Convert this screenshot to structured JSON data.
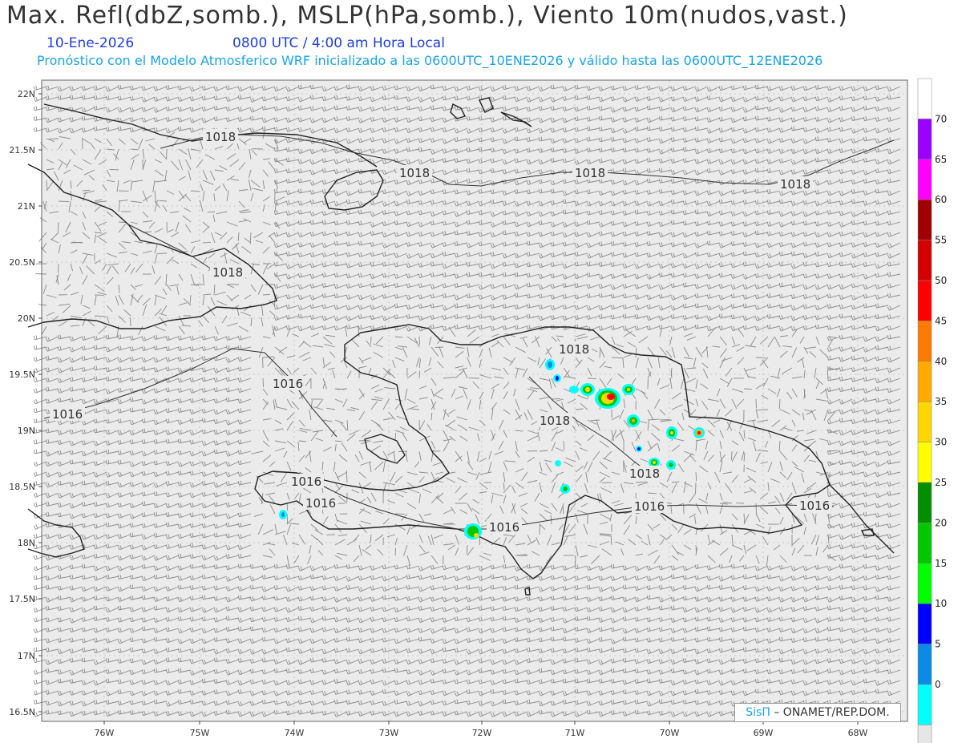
{
  "header": {
    "title": "Max. Refl(dbZ,somb.), MSLP(hPa,somb.), Viento 10m(nudos,vast.)",
    "date": "10-Ene-2026",
    "time": "0800 UTC / 4:00 am Hora Local",
    "model_info": "Pronóstico con el Modelo Atmosferico WRF inicializado a las 0600UTC_10ENE2026 y válido hasta las  0600UTC_12ENE2026"
  },
  "axes": {
    "lat_labels": [
      "22N",
      "21.5N",
      "21N",
      "20.5N",
      "20N",
      "19.5N",
      "19N",
      "18.5N",
      "18N",
      "17.5N",
      "17N",
      "16.5N"
    ],
    "lon_labels": [
      "76W",
      "75W",
      "74W",
      "73W",
      "72W",
      "71W",
      "70W",
      "69W",
      "68W"
    ]
  },
  "isobars": [
    {
      "label": "1018"
    },
    {
      "label": "1018"
    },
    {
      "label": "1018"
    },
    {
      "label": "1018"
    },
    {
      "label": "1018"
    },
    {
      "label": "1018"
    },
    {
      "label": "1018"
    },
    {
      "label": "1018"
    },
    {
      "label": "1016"
    },
    {
      "label": "1016"
    },
    {
      "label": "1016"
    },
    {
      "label": "1016"
    },
    {
      "label": "1016"
    },
    {
      "label": "1016"
    },
    {
      "label": "1016"
    }
  ],
  "colorbar": {
    "ticks": [
      "70",
      "65",
      "60",
      "55",
      "50",
      "45",
      "40",
      "35",
      "30",
      "25",
      "20",
      "15",
      "10",
      "5",
      "0"
    ],
    "colors": [
      "#ffffff",
      "#9a00ff",
      "#ff00ff",
      "#a00000",
      "#d40000",
      "#ff0000",
      "#ff7a00",
      "#ffaa00",
      "#ffd700",
      "#ffff00",
      "#008f00",
      "#00c800",
      "#00ff00",
      "#0000ff",
      "#0a8ce6",
      "#00ffff",
      "#e6e6e6"
    ]
  },
  "credit": {
    "logo": "SisΠ",
    "text": " – ONAMET/REP.DOM."
  },
  "colors": {
    "map_bg": "#ebebeb",
    "coast": "#222222",
    "barb": "#8a8a8a"
  }
}
